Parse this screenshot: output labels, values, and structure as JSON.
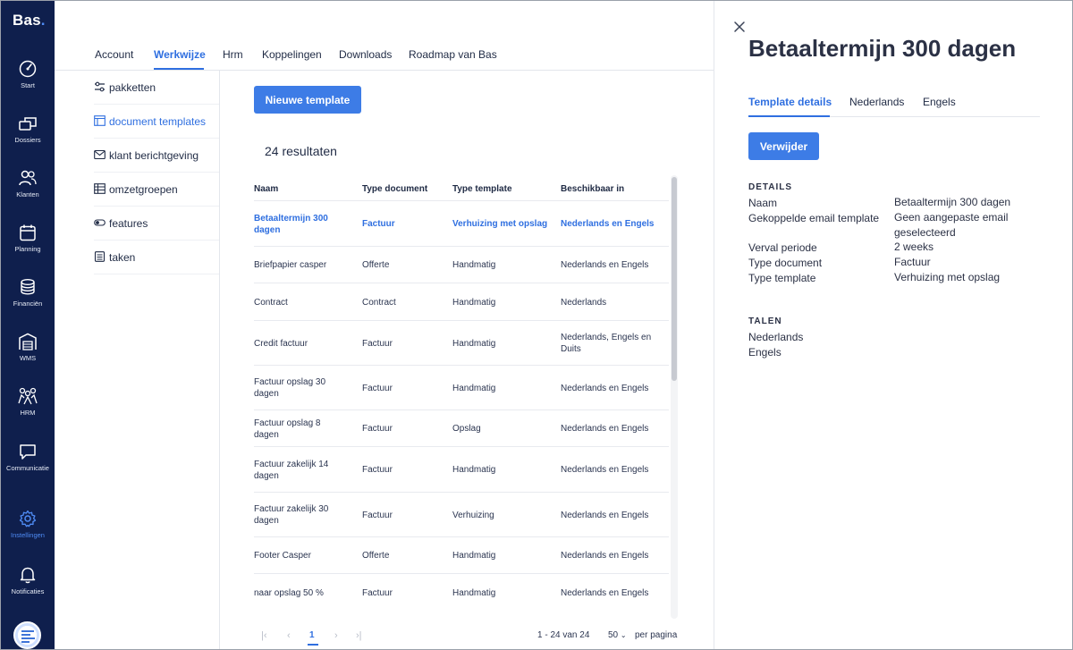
{
  "app": {
    "logo": "Bas",
    "logo_dot": "."
  },
  "nav": [
    {
      "label": "Start",
      "icon": "gauge-icon"
    },
    {
      "label": "Dossiers",
      "icon": "folders-icon"
    },
    {
      "label": "Klanten",
      "icon": "users-icon"
    },
    {
      "label": "Planning",
      "icon": "calendar-icon"
    },
    {
      "label": "Financiën",
      "icon": "coins-icon"
    },
    {
      "label": "WMS",
      "icon": "warehouse-icon"
    },
    {
      "label": "HRM",
      "icon": "team-icon"
    },
    {
      "label": "Communicatie",
      "icon": "chat-icon"
    },
    {
      "label": "Instellingen",
      "icon": "gear-icon",
      "active": true
    },
    {
      "label": "Notificaties",
      "icon": "bell-icon"
    }
  ],
  "tabs": [
    {
      "label": "Account"
    },
    {
      "label": "Werkwijze",
      "active": true
    },
    {
      "label": "Hrm"
    },
    {
      "label": "Koppelingen"
    },
    {
      "label": "Downloads"
    },
    {
      "label": "Roadmap van Bas"
    }
  ],
  "submenu": [
    {
      "label": "pakketten",
      "icon": "sliders-icon"
    },
    {
      "label": "document templates",
      "icon": "document-icon",
      "active": true
    },
    {
      "label": "klant berichtgeving",
      "icon": "mail-icon"
    },
    {
      "label": "omzetgroepen",
      "icon": "table-icon"
    },
    {
      "label": "features",
      "icon": "toggle-icon"
    },
    {
      "label": "taken",
      "icon": "checklist-icon"
    }
  ],
  "main": {
    "new_button": "Nieuwe template",
    "results": "24 resultaten",
    "columns": [
      "Naam",
      "Type document",
      "Type template",
      "Beschikbaar in"
    ],
    "rows": [
      {
        "name": "Betaaltermijn 300 dagen",
        "doc": "Factuur",
        "tpl": "Verhuizing met opslag",
        "avail": "Nederlands en Engels",
        "highlight": true
      },
      {
        "name": "Briefpapier casper",
        "doc": "Offerte",
        "tpl": "Handmatig",
        "avail": "Nederlands en Engels"
      },
      {
        "name": "Contract",
        "doc": "Contract",
        "tpl": "Handmatig",
        "avail": "Nederlands"
      },
      {
        "name": "Credit factuur",
        "doc": "Factuur",
        "tpl": "Handmatig",
        "avail": "Nederlands, Engels en Duits"
      },
      {
        "name": "Factuur opslag 30 dagen",
        "doc": "Factuur",
        "tpl": "Handmatig",
        "avail": "Nederlands en Engels"
      },
      {
        "name": "Factuur opslag 8 dagen",
        "doc": "Factuur",
        "tpl": "Opslag",
        "avail": "Nederlands en Engels"
      },
      {
        "name": "Factuur zakelijk 14 dagen",
        "doc": "Factuur",
        "tpl": "Handmatig",
        "avail": "Nederlands en Engels"
      },
      {
        "name": "Factuur zakelijk 30 dagen",
        "doc": "Factuur",
        "tpl": "Verhuizing",
        "avail": "Nederlands en Engels"
      },
      {
        "name": "Footer Casper",
        "doc": "Offerte",
        "tpl": "Handmatig",
        "avail": "Nederlands en Engels"
      },
      {
        "name": "naar opslag 50 %",
        "doc": "Factuur",
        "tpl": "Handmatig",
        "avail": "Nederlands en Engels"
      }
    ],
    "pagination": {
      "current_page": "1",
      "range": "1 - 24 van 24",
      "per_page": "50",
      "per_page_label": "per pagina",
      "first": "|‹",
      "prev": "‹",
      "next": "›",
      "last": "›|"
    }
  },
  "panel": {
    "title": "Betaaltermijn 300 dagen",
    "tabs": [
      {
        "label": "Template details",
        "active": true
      },
      {
        "label": "Nederlands"
      },
      {
        "label": "Engels"
      }
    ],
    "delete_button": "Verwijder",
    "details_heading": "DETAILS",
    "details": [
      {
        "label": "Naam",
        "value": "Betaaltermijn 300 dagen"
      },
      {
        "label": "Gekoppelde email template",
        "value": "Geen aangepaste email geselecteerd"
      },
      {
        "label": "Verval periode",
        "value": "2 weeks"
      },
      {
        "label": "Type document",
        "value": "Factuur"
      },
      {
        "label": "Type template",
        "value": "Verhuizing met opslag"
      }
    ],
    "languages_heading": "TALEN",
    "languages": [
      "Nederlands",
      "Engels"
    ]
  },
  "colors": {
    "nav_bg": "#0f1f4d",
    "accent": "#3d7ce6",
    "link": "#2f6fe0"
  }
}
